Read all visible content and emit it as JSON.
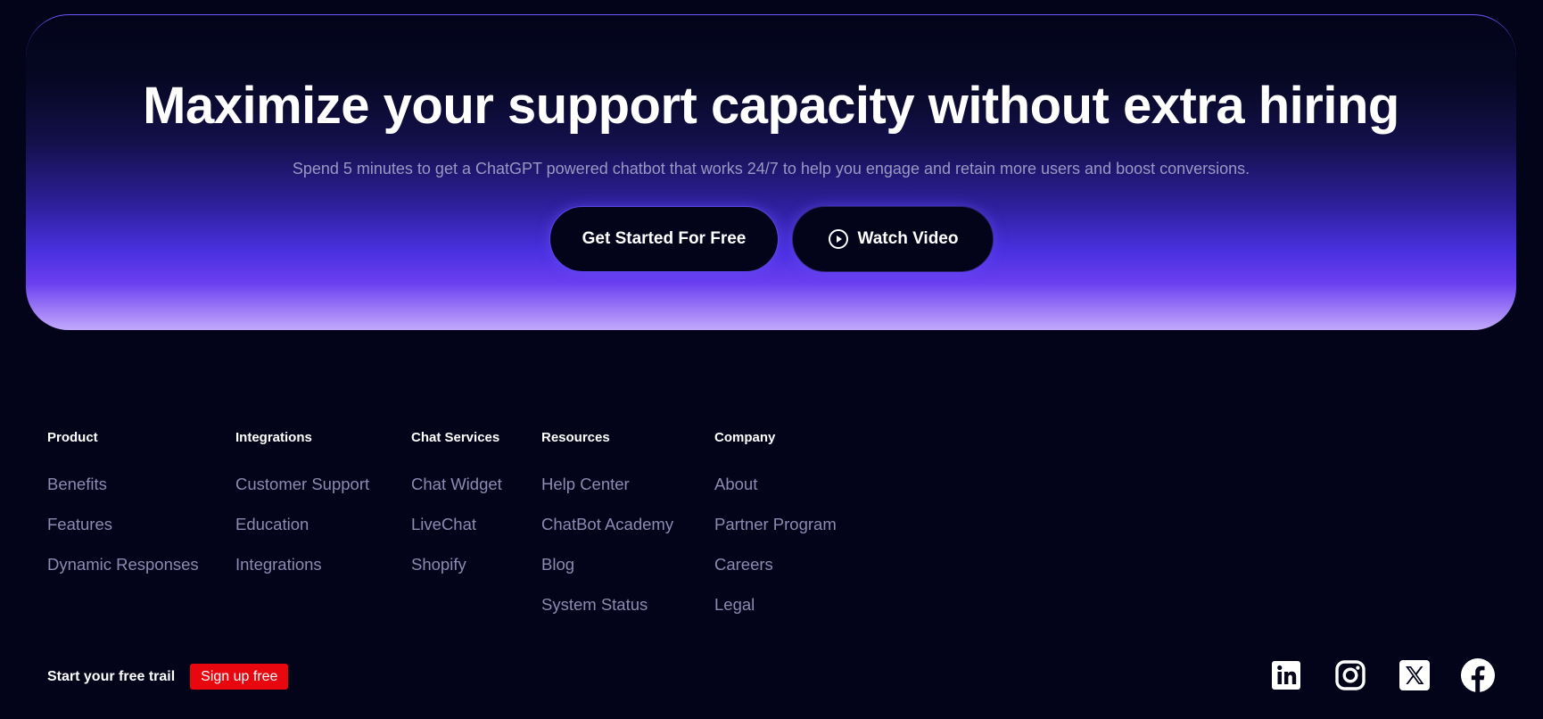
{
  "hero": {
    "title": "Maximize your support capacity without extra hiring",
    "subtitle": "Spend 5 minutes to get a ChatGPT powered chatbot that works 24/7 to help you engage and retain more users and boost conversions.",
    "primary_button": "Get Started For Free",
    "video_button": "Watch Video",
    "video_icon": "play-circle-icon"
  },
  "footer": {
    "columns": [
      {
        "heading": "Product",
        "items": [
          "Benefits",
          "Features",
          "Dynamic Responses"
        ]
      },
      {
        "heading": "Integrations",
        "items": [
          "Customer Support",
          "Education",
          "Integrations"
        ]
      },
      {
        "heading": "Chat Services",
        "items": [
          "Chat Widget",
          "LiveChat",
          "Shopify"
        ]
      },
      {
        "heading": "Resources",
        "items": [
          "Help Center",
          "ChatBot Academy",
          "Blog",
          "System Status"
        ]
      },
      {
        "heading": "Company",
        "items": [
          "About",
          "Partner Program",
          "Careers",
          "Legal"
        ]
      }
    ],
    "trail_label": "Start your free trail",
    "signup_button": "Sign up free",
    "social_icons": [
      "linkedin-icon",
      "instagram-icon",
      "x-icon",
      "facebook-icon"
    ]
  },
  "colors": {
    "background": "#03041a",
    "accent": "#6a3ff0",
    "signup": "#e8070f",
    "muted_text": "#8c8ab0"
  }
}
